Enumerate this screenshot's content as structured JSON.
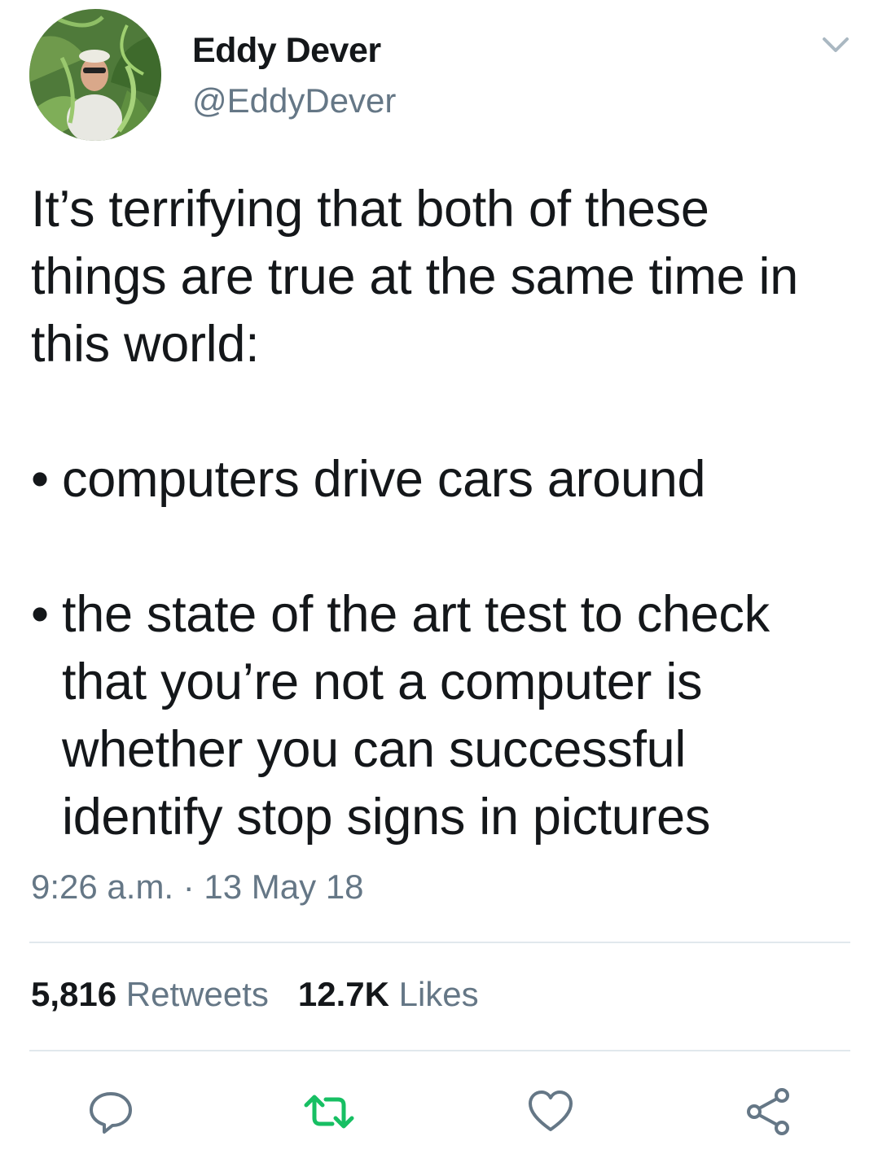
{
  "author": {
    "display_name": "Eddy Dever",
    "handle": "@EddyDever"
  },
  "tweet": {
    "intro": "It’s terrifying that both of these things are true at the same time in this world:",
    "bullets": [
      "computers drive cars around",
      "the state of the art test to check that you’re not a computer is whether you can successful identify stop signs in pictures"
    ],
    "timestamp": "9:26 a.m. · 13 May 18"
  },
  "stats": {
    "retweets_count": "5,816",
    "retweets_label": "Retweets",
    "likes_count": "12.7K",
    "likes_label": "Likes"
  },
  "actions": [
    {
      "icon": "reply-icon"
    },
    {
      "icon": "retweet-icon"
    },
    {
      "icon": "like-icon"
    },
    {
      "icon": "share-icon"
    }
  ],
  "colors": {
    "text": "#14171a",
    "secondary": "#657786",
    "divider": "#e1e8ed",
    "retweet_green": "#17bf63"
  }
}
